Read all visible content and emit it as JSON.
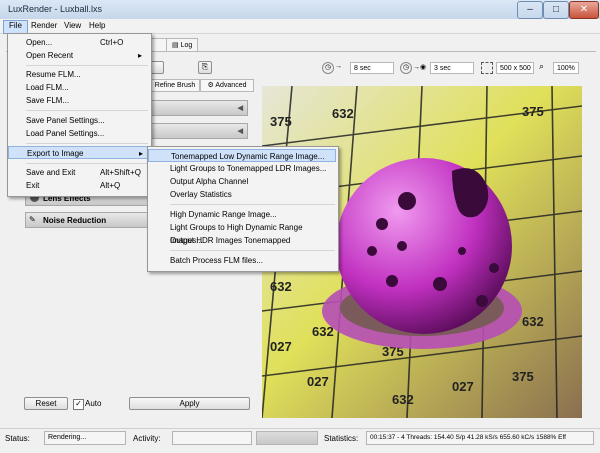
{
  "window": {
    "title": "LuxRender - Luxball.lxs"
  },
  "menubar": {
    "items": [
      "File",
      "Render",
      "View",
      "Help"
    ]
  },
  "tabs": {
    "log": "Log"
  },
  "panel_tabs": {
    "refine": "Refine Brush",
    "advanced": "Advanced"
  },
  "toolbar": {
    "time1": "8 sec",
    "time2": "3 sec",
    "resolution": "500 x 500",
    "zoom": "100%"
  },
  "panels": {
    "lens_effects": "Lens Effects",
    "noise_reduction": "Noise Reduction"
  },
  "bottom_buttons": {
    "reset": "Reset",
    "auto": "Auto",
    "auto_checked": true,
    "apply": "Apply"
  },
  "file_menu": {
    "items": [
      {
        "label": "Open...",
        "shortcut": "Ctrl+O"
      },
      {
        "label": "Open Recent",
        "shortcut": ""
      },
      {
        "label": "Resume FLM...",
        "shortcut": ""
      },
      {
        "label": "Load FLM...",
        "shortcut": ""
      },
      {
        "label": "Save FLM...",
        "shortcut": ""
      },
      {
        "label": "Save Panel Settings...",
        "shortcut": ""
      },
      {
        "label": "Load Panel Settings...",
        "shortcut": ""
      },
      {
        "label": "Export to Image",
        "shortcut": ""
      },
      {
        "label": "Save and Exit",
        "shortcut": "Alt+Shift+Q"
      },
      {
        "label": "Exit",
        "shortcut": "Alt+Q"
      }
    ]
  },
  "export_menu": {
    "items": [
      "Tonemapped Low Dynamic Range Image...",
      "Light Groups to Tonemapped LDR Images...",
      "Output Alpha Channel",
      "Overlay Statistics",
      "High Dynamic Range Image...",
      "Light Groups to High Dynamic Range Images...",
      "Output HDR Images Tonemapped",
      "Batch Process FLM files..."
    ]
  },
  "render_numbers": [
    "375",
    "632",
    "027",
    "375",
    "632",
    "027",
    "375",
    "632",
    "027",
    "375",
    "632",
    "027",
    "375",
    "632"
  ],
  "statusbar": {
    "status_label": "Status:",
    "status_value": "Rendering...",
    "activity_label": "Activity:",
    "statistics_label": "Statistics:",
    "statistics_value": "00:15:37 - 4 Threads: 154.40 S/p 41.28 kS/s 655.60 kC/s 1588% Eff"
  },
  "colors": {
    "menu_highlight": "#cfe2f9",
    "render_magenta": "#d23ad2",
    "render_yellow": "#e2e25a"
  },
  "icons": [
    "app-icon",
    "minimize-icon",
    "maximize-icon",
    "close-icon",
    "submenu-arrow-icon",
    "timer-icon",
    "eye-timer-icon",
    "resolution-icon",
    "zoom-icon",
    "chevron-left-icon"
  ]
}
